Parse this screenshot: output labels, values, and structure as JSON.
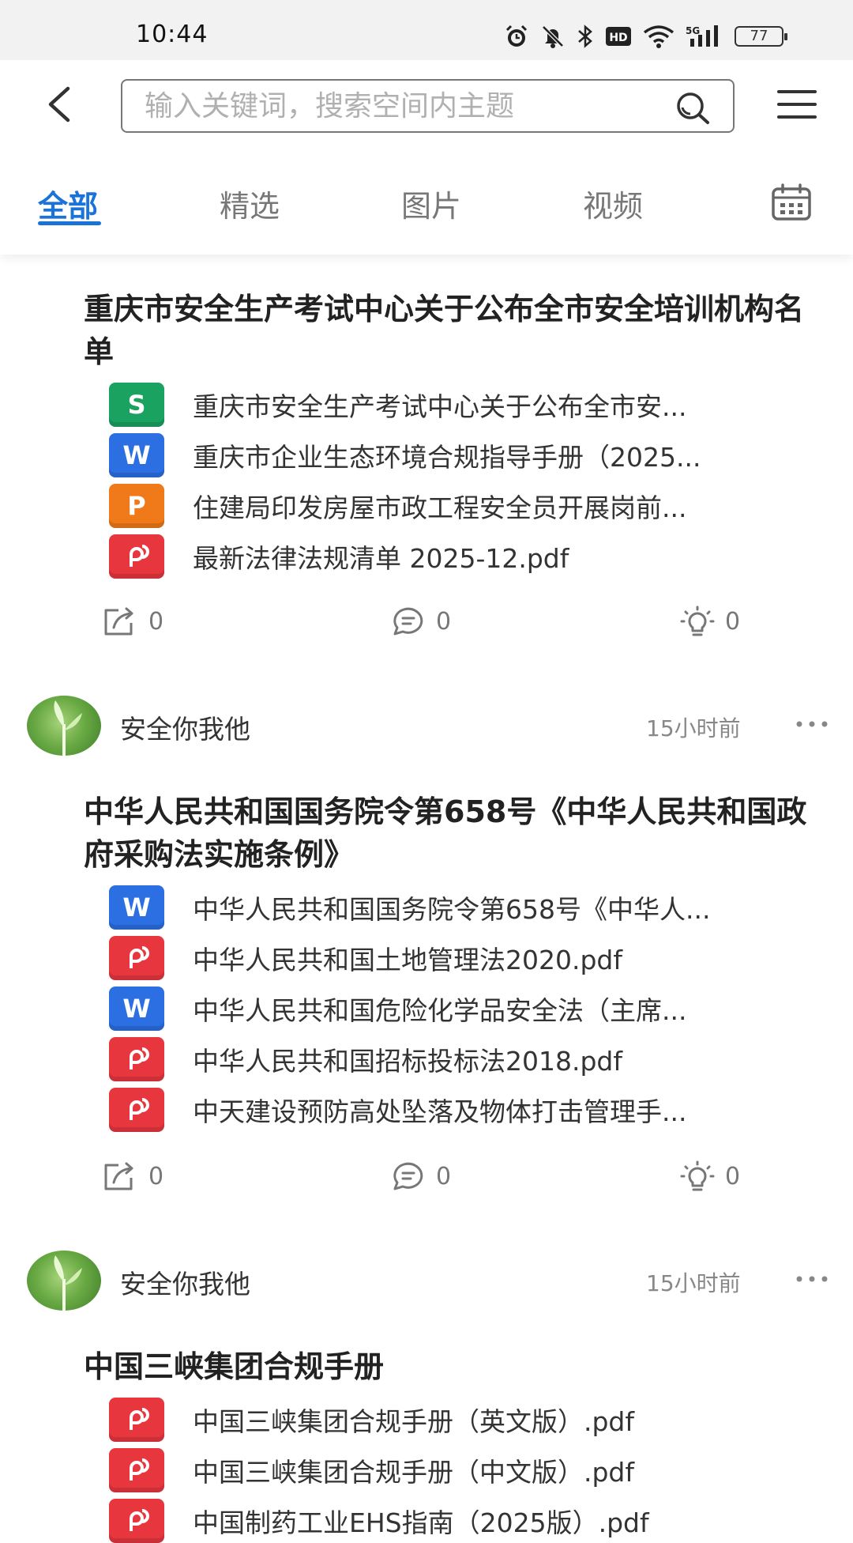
{
  "status_bar": {
    "time": "10:44",
    "battery": "77",
    "icons": [
      "alarm-icon",
      "mute-icon",
      "bluetooth-icon",
      "hd-icon",
      "wifi-icon",
      "signal-5g-icon",
      "battery-icon"
    ]
  },
  "header": {
    "search_placeholder": "输入关键词，搜索空间内主题"
  },
  "tabs": [
    {
      "label": "全部",
      "active": true
    },
    {
      "label": "精选",
      "active": false
    },
    {
      "label": "图片",
      "active": false
    },
    {
      "label": "视频",
      "active": false
    }
  ],
  "posts": [
    {
      "title": "重庆市安全生产考试中心关于公布全市安全培训机构名单",
      "files": [
        {
          "type": "S",
          "name": "重庆市安全生产考试中心关于公布全市安..."
        },
        {
          "type": "W",
          "name": "重庆市企业生态环境合规指导手册（2025..."
        },
        {
          "type": "P",
          "name": "住建局印发房屋市政工程安全员开展岗前..."
        },
        {
          "type": "pdf",
          "name": "最新法律法规清单 2025-12.pdf"
        }
      ],
      "shares": "0",
      "comments": "0",
      "likes": "0"
    },
    {
      "author": "安全你我他",
      "time": "15小时前",
      "title": "中华人民共和国国务院令第658号《中华人民共和国政府采购法实施条例》",
      "files": [
        {
          "type": "W",
          "name": "中华人民共和国国务院令第658号《中华人..."
        },
        {
          "type": "pdf",
          "name": "中华人民共和国土地管理法2020.pdf"
        },
        {
          "type": "W",
          "name": "中华人民共和国危险化学品安全法（主席..."
        },
        {
          "type": "pdf",
          "name": "中华人民共和国招标投标法2018.pdf"
        },
        {
          "type": "pdf",
          "name": "中天建设预防高处坠落及物体打击管理手..."
        }
      ],
      "shares": "0",
      "comments": "0",
      "likes": "0"
    },
    {
      "author": "安全你我他",
      "time": "15小时前",
      "title": "中国三峡集团合规手册",
      "files": [
        {
          "type": "pdf",
          "name": "中国三峡集团合规手册（英文版）.pdf"
        },
        {
          "type": "pdf",
          "name": "中国三峡集团合规手册（中文版）.pdf"
        },
        {
          "type": "pdf",
          "name": "中国制药工业EHS指南（2025版）.pdf"
        }
      ]
    }
  ],
  "colors": {
    "accent": "#1a73d9",
    "sheet": "#1aa260",
    "word": "#2b6fe3",
    "ppt": "#f07a1a",
    "pdf": "#e8363f"
  }
}
